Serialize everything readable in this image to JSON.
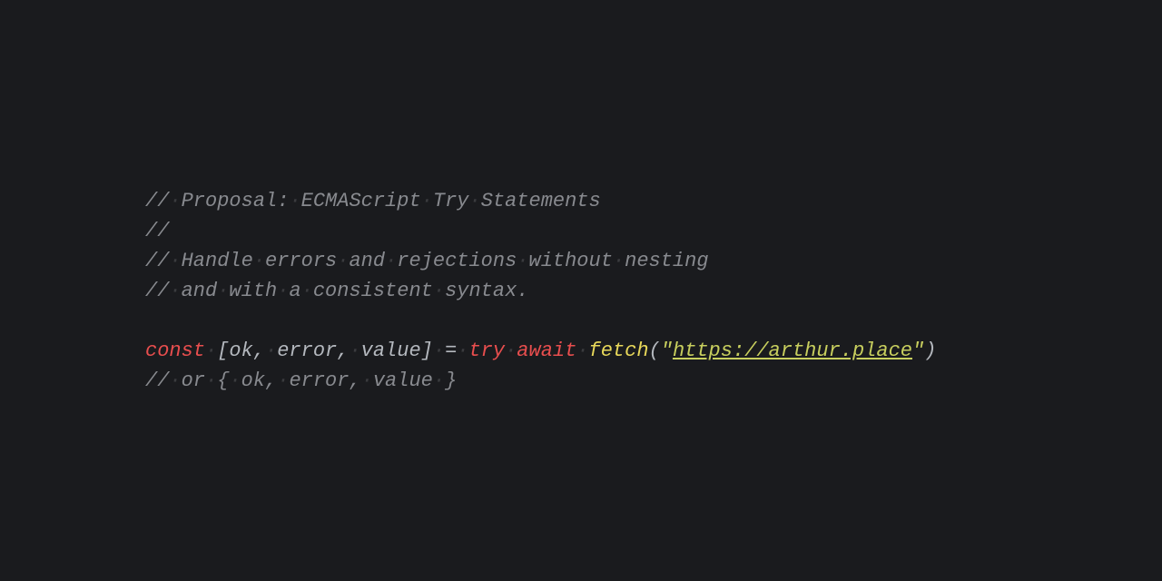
{
  "code": {
    "line1": {
      "prefix": "//",
      "text": "Proposal: ECMAScript Try Statements"
    },
    "line2": {
      "prefix": "//"
    },
    "line3": {
      "prefix": "//",
      "text": "Handle errors and rejections without nesting"
    },
    "line4": {
      "prefix": "//",
      "text": "and with a consistent syntax."
    },
    "line6": {
      "const": "const",
      "open": "[",
      "id1": "ok",
      "comma1": ",",
      "id2": "error",
      "comma2": ",",
      "id3": "value",
      "close": "]",
      "eq": "=",
      "try": "try",
      "await": "await",
      "fn": "fetch",
      "paren_open": "(",
      "quote_open": "\"",
      "url": "https://arthur.place",
      "quote_close": "\"",
      "paren_close": ")"
    },
    "line7": {
      "prefix": "//",
      "text": "or { ok, error, value }"
    },
    "dot": "·"
  }
}
